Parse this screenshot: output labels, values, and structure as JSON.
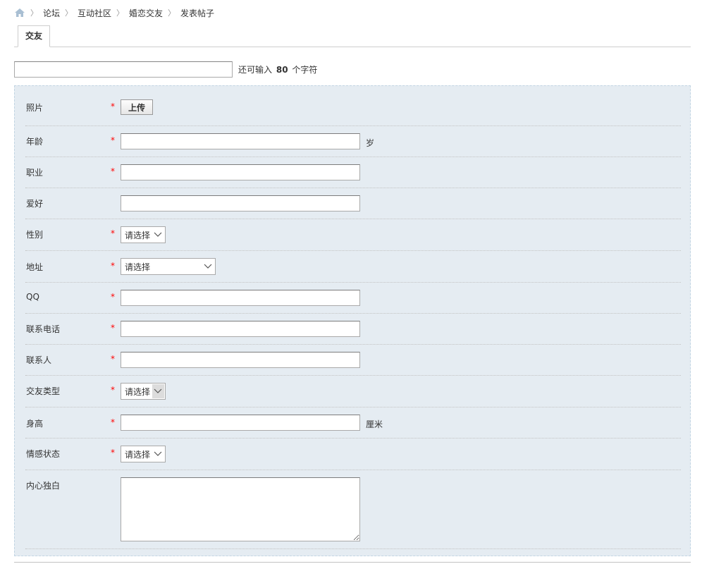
{
  "breadcrumb": {
    "items": [
      "论坛",
      "互动社区",
      "婚恋交友",
      "发表帖子"
    ]
  },
  "tab": {
    "label": "交友"
  },
  "title_field": {
    "value": "",
    "counter_prefix": "还可输入",
    "counter_number": "80",
    "counter_suffix": "个字符"
  },
  "form": {
    "photo": {
      "label": "照片",
      "button": "上传"
    },
    "age": {
      "label": "年龄",
      "value": "",
      "unit": "岁"
    },
    "job": {
      "label": "职业",
      "value": ""
    },
    "hobby": {
      "label": "爱好",
      "value": ""
    },
    "gender": {
      "label": "性别",
      "selected": "请选择"
    },
    "address": {
      "label": "地址",
      "selected": "请选择"
    },
    "qq": {
      "label": "QQ",
      "value": ""
    },
    "phone": {
      "label": "联系电话",
      "value": ""
    },
    "contact": {
      "label": "联系人",
      "value": ""
    },
    "friend_type": {
      "label": "交友类型",
      "selected": "请选择"
    },
    "height": {
      "label": "身高",
      "value": "",
      "unit": "厘米"
    },
    "relationship": {
      "label": "情感状态",
      "selected": "请选择"
    },
    "monologue": {
      "label": "内心独白",
      "value": ""
    }
  },
  "required_mark": "*",
  "colors": {
    "panel_bg": "#e5ecf2",
    "required": "#ff0000",
    "border": "#a9a9a9"
  }
}
